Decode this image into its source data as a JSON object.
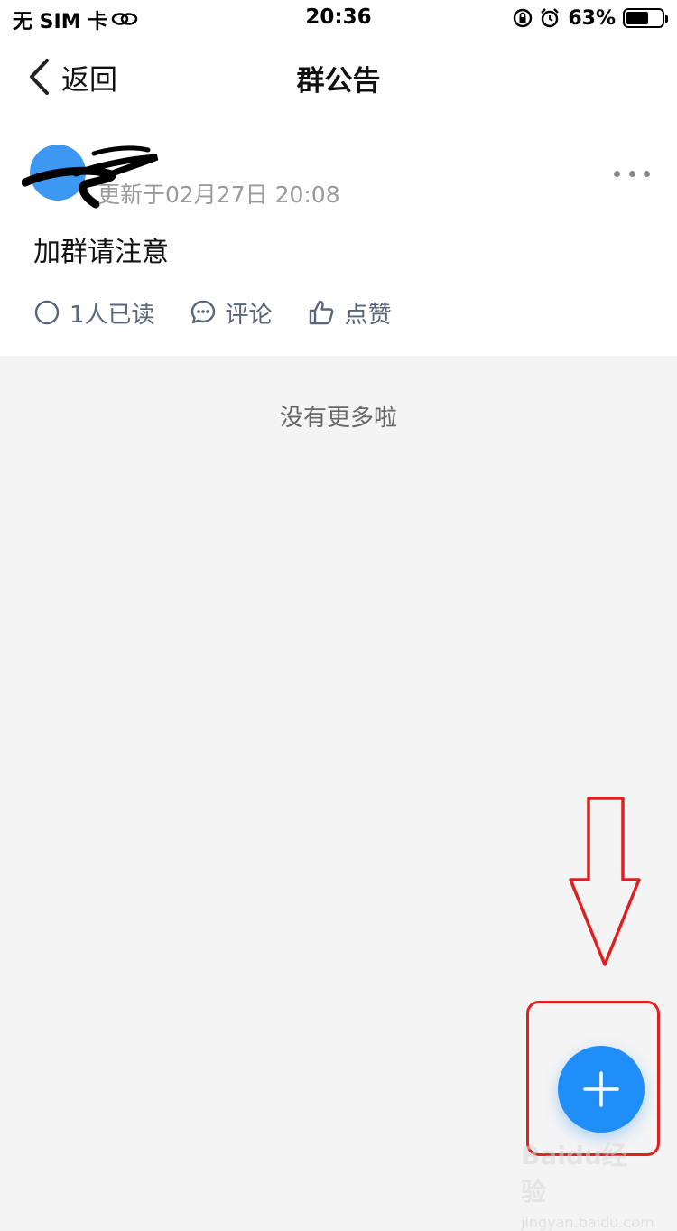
{
  "status_bar": {
    "carrier": "无 SIM 卡",
    "time": "20:36",
    "battery_percent": "63%",
    "battery_level": 0.63
  },
  "nav": {
    "back_label": "返回",
    "title": "群公告"
  },
  "announcement": {
    "author": "",
    "updated": "更新于02月27日 20:08",
    "content": "加群请注意",
    "read_label": "1人已读",
    "comment_label": "评论",
    "like_label": "点赞"
  },
  "footer_text": "没有更多啦",
  "watermark": {
    "logo": "Baidu经验",
    "sub": "jingyan.baidu.com"
  },
  "colors": {
    "accent": "#1f8ef8",
    "avatar": "#3d98f3",
    "annotation": "#e02020"
  }
}
